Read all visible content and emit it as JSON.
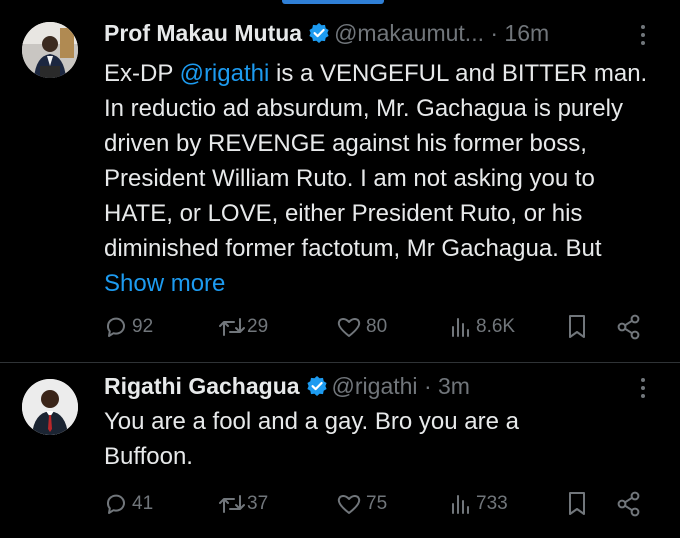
{
  "tweets": [
    {
      "name": "Prof Makau Mutua",
      "handle": "@makaumut...",
      "time": "· 16m",
      "body_prefix": "Ex-DP ",
      "mention": "@rigathi",
      "body_rest": " is a VENGEFUL and BITTER man.  In reductio ad absurdum, Mr. Gachagua is purely driven by REVENGE against his former boss, President William Ruto.  I am not asking you to HATE, or LOVE, either President Ruto, or his diminished former factotum, Mr Gachagua.  But ",
      "show_more": "Show more",
      "replies": "92",
      "retweets": "29",
      "likes": "80",
      "views": "8.6K",
      "icons": [
        "verified-badge-icon",
        "more-icon",
        "reply-icon",
        "retweet-icon",
        "like-icon",
        "views-icon",
        "bookmark-icon",
        "share-icon"
      ]
    },
    {
      "name": "Rigathi Gachagua",
      "handle": "@rigathi",
      "time": "· 3m",
      "body": "You are  a fool and a gay. Bro you are a Buffoon.",
      "replies": "41",
      "retweets": "37",
      "likes": "75",
      "views": "733",
      "icons": [
        "verified-badge-icon",
        "more-icon",
        "reply-icon",
        "retweet-icon",
        "like-icon",
        "views-icon",
        "bookmark-icon",
        "share-icon"
      ]
    }
  ],
  "colors": {
    "background": "#000000",
    "text": "#e7e9ea",
    "secondary": "#71767b",
    "link": "#1d9bf0",
    "verified": "#1d9bf0"
  }
}
